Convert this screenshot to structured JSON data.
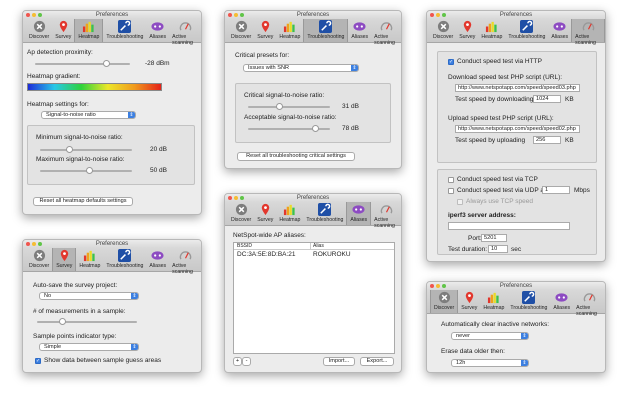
{
  "title": "Preferences",
  "toolbar": {
    "discover": "Discover",
    "survey": "Survey",
    "heatmap": "Heatmap",
    "troubleshooting": "Troubleshooting",
    "aliases": "Aliases",
    "active_scanning": "Active scanning"
  },
  "icons": [
    "close-circle-icon",
    "map-pin-icon",
    "heatmap-bars-icon",
    "wrench-icon",
    "alias-tag-icon",
    "gauge-icon"
  ],
  "heatmap": {
    "ap_label": "Ap detection proximity:",
    "ap_value": "-28 dBm",
    "gradient_label": "Heatmap gradient:",
    "settings_label": "Heatmap settings for:",
    "settings_value": "Signal-to-noise ratio",
    "min_label": "Minimum signal-to-noise ratio:",
    "min_value": "20 dB",
    "max_label": "Maximum signal-to-noise ratio:",
    "max_value": "50 dB",
    "reset": "Reset all heatmap defaults settings"
  },
  "trouble": {
    "presets_label": "Critical presets for:",
    "presets_value": "Issues with SNR",
    "ratio_label": "Critical signal-to-noise ratio:",
    "ratio_value": "31 dB",
    "acc_label": "Acceptable signal-to-noise ratio:",
    "acc_value": "78 dB",
    "reset": "Reset all troubleshooting critical settings"
  },
  "active": {
    "http_label": "Conduct speed test via HTTP",
    "dl_label": "Download speed test PHP script (URL):",
    "dl_url": "http://www.netspotapp.com/speed/speed03.php",
    "dl_by": "Test speed by downloading",
    "dl_val": "1024",
    "dl_unit": "KB",
    "ul_label": "Upload speed test PHP script (URL):",
    "ul_url": "http://www.netspotapp.com/speed/speed02.php",
    "ul_by": "Test speed by uploading",
    "ul_val": "256",
    "ul_unit": "KB",
    "tcp_label": "Conduct speed test via TCP",
    "udp_label": "Conduct speed test via UDP at",
    "udp_val": "1",
    "udp_unit": "Mbps",
    "always_tcp": "Always use TCP speed",
    "iperf_label": "iperf3 server address:",
    "port_label": "Port:",
    "port_val": "5201",
    "dur_label": "Test duration:",
    "dur_val": "10",
    "dur_unit": "sec"
  },
  "survey": {
    "autosave_label": "Auto-save the survey project:",
    "autosave_value": "No",
    "measure_label": "# of measurements in a sample:",
    "points_label": "Sample points indicator type:",
    "points_value": "Simple",
    "show_label": "Show data between sample guess areas"
  },
  "aliases": {
    "label": "NetSpot-wide AP aliases:",
    "col_bssid": "BSSID",
    "col_alias": "Alias",
    "rows": [
      {
        "bssid": "DC:3A:5E:8D:BA:21",
        "alias": "ROKUROKU"
      }
    ],
    "add": "+",
    "remove": "-",
    "import": "Import...",
    "export": "Export..."
  },
  "discover": {
    "clear_label": "Automatically clear inactive networks:",
    "clear_value": "never",
    "erase_label": "Erase data older then:",
    "erase_value": "12h"
  }
}
